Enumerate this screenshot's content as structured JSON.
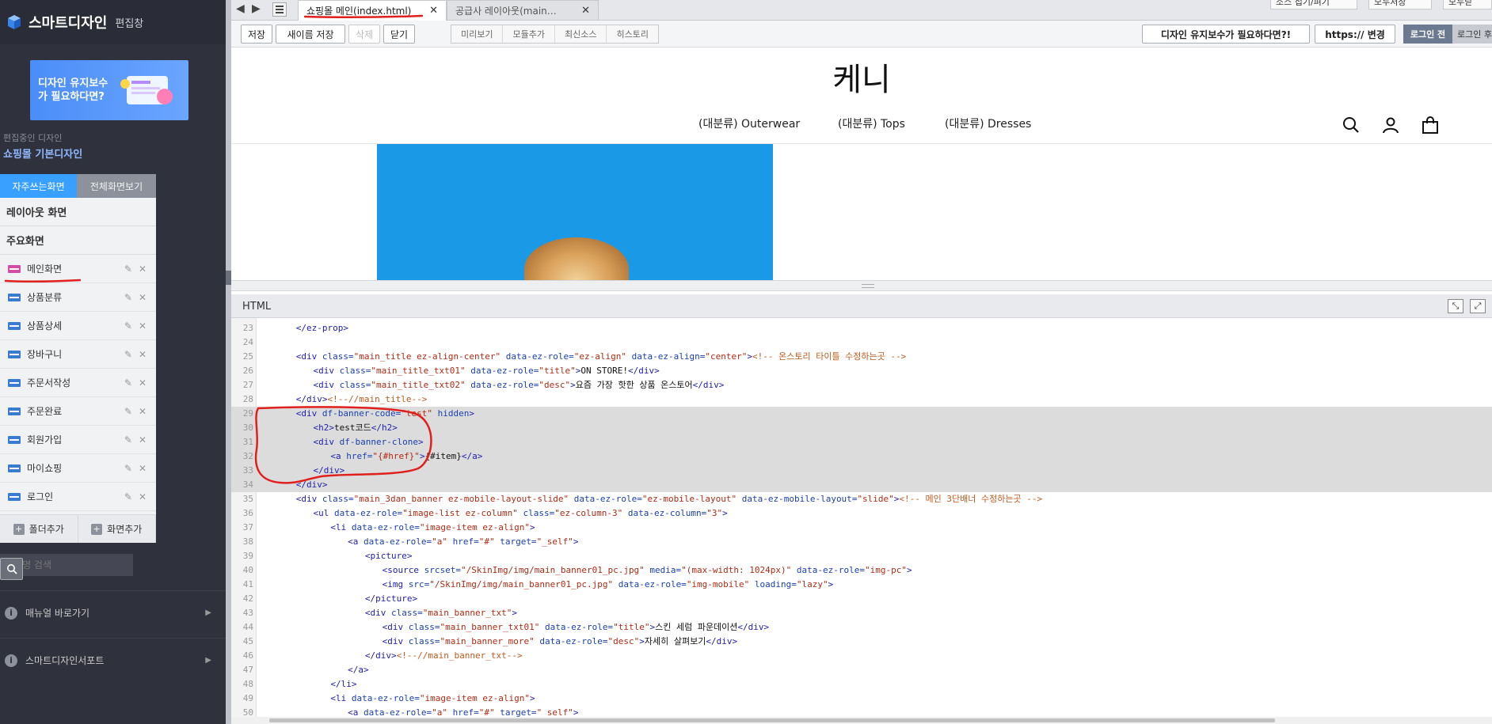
{
  "sidebar": {
    "brand": "스마트디자인",
    "brand_sub": "편집창",
    "banner_text": "디자인 유지보수가 필요하다면?",
    "design_label": "편집중인 디자인",
    "design_name": "쇼핑몰 기본디자인",
    "tabs": [
      "자주쓰는화면",
      "전체화면보기"
    ],
    "sections": [
      "레이아웃 화면",
      "주요화면"
    ],
    "items": [
      {
        "label": "메인화면"
      },
      {
        "label": "상품분류"
      },
      {
        "label": "상품상세"
      },
      {
        "label": "장바구니"
      },
      {
        "label": "주문서작성"
      },
      {
        "label": "주문완료"
      },
      {
        "label": "회원가입"
      },
      {
        "label": "마이쇼핑"
      },
      {
        "label": "로그인"
      }
    ],
    "add_folder": "폴더추가",
    "add_screen": "화면추가",
    "search_placeholder": "화면명 검색",
    "links": [
      "매뉴얼 바로가기",
      "스마트디자인서포트"
    ]
  },
  "tabbar": {
    "active_tab": "쇼핑몰 메인(index.html)",
    "inactive_tab": "공급사 레이아웃(main…",
    "right_buttons": [
      "소스 접기/펴기",
      "모두저장",
      "모두닫"
    ]
  },
  "toolbar": {
    "save": "저장",
    "save_as": "새이름 저장",
    "delete": "삭제",
    "close": "닫기",
    "segments": [
      "미리보기",
      "모듈추가",
      "최신소스",
      "히스토리"
    ],
    "maintenance": "디자인 유지보수가 필요하다면?!",
    "https": "https:// 변경",
    "login_before": "로그인 전",
    "login_after": "로그인 후"
  },
  "preview": {
    "shop_name": "케니",
    "nav": [
      "(대분류) Outerwear",
      "(대분류) Tops",
      "(대분류) Dresses"
    ]
  },
  "code_panel": {
    "title": "HTML"
  },
  "code_lines": [
    {
      "n": "23",
      "indent": 2,
      "hl": false,
      "parts": [
        [
          "t-tag",
          "</ez-prop>"
        ]
      ]
    },
    {
      "n": "24",
      "indent": 0,
      "hl": false,
      "parts": []
    },
    {
      "n": "25",
      "indent": 2,
      "hl": false,
      "parts": [
        [
          "t-tag",
          "<div "
        ],
        [
          "t-attr",
          "class="
        ],
        [
          "t-str",
          "\"main_title ez-align-center\""
        ],
        [
          "t-attr",
          " data-ez-role="
        ],
        [
          "t-str",
          "\"ez-align\""
        ],
        [
          "t-attr",
          " data-ez-align="
        ],
        [
          "t-str",
          "\"center\""
        ],
        [
          "t-tag",
          ">"
        ],
        [
          "t-com",
          "<!-- 온스토리 타이틀 수정하는곳 -->"
        ]
      ]
    },
    {
      "n": "26",
      "indent": 4,
      "hl": false,
      "parts": [
        [
          "t-tag",
          "<div "
        ],
        [
          "t-attr",
          "class="
        ],
        [
          "t-str",
          "\"main_title_txt01\""
        ],
        [
          "t-attr",
          " data-ez-role="
        ],
        [
          "t-str",
          "\"title\""
        ],
        [
          "t-tag",
          ">"
        ],
        [
          "t-txt",
          "ON STORE!"
        ],
        [
          "t-tag",
          "</div>"
        ]
      ]
    },
    {
      "n": "27",
      "indent": 4,
      "hl": false,
      "parts": [
        [
          "t-tag",
          "<div "
        ],
        [
          "t-attr",
          "class="
        ],
        [
          "t-str",
          "\"main_title_txt02\""
        ],
        [
          "t-attr",
          " data-ez-role="
        ],
        [
          "t-str",
          "\"desc\""
        ],
        [
          "t-tag",
          ">"
        ],
        [
          "t-txt",
          "요즘 가장 핫한 상품 온스토어"
        ],
        [
          "t-tag",
          "</div>"
        ]
      ]
    },
    {
      "n": "28",
      "indent": 2,
      "hl": false,
      "parts": [
        [
          "t-tag",
          "</div>"
        ],
        [
          "t-com",
          "<!--//main_title-->"
        ]
      ]
    },
    {
      "n": "29",
      "indent": 2,
      "hl": true,
      "parts": [
        [
          "t-tag",
          "<div "
        ],
        [
          "t-attr",
          "df-banner-code="
        ],
        [
          "t-str",
          "\"test\""
        ],
        [
          "t-attr",
          " hidden"
        ],
        [
          "t-tag",
          ">"
        ]
      ]
    },
    {
      "n": "30",
      "indent": 4,
      "hl": true,
      "parts": [
        [
          "t-tag",
          "<h2>"
        ],
        [
          "t-txt",
          "test코드"
        ],
        [
          "t-tag",
          "</h2>"
        ]
      ]
    },
    {
      "n": "31",
      "indent": 4,
      "hl": true,
      "parts": [
        [
          "t-tag",
          "<div "
        ],
        [
          "t-attr",
          "df-banner-clone"
        ],
        [
          "t-tag",
          ">"
        ]
      ]
    },
    {
      "n": "32",
      "indent": 6,
      "hl": true,
      "parts": [
        [
          "t-tag",
          "<a "
        ],
        [
          "t-attr",
          "href="
        ],
        [
          "t-str",
          "\"{#href}\""
        ],
        [
          "t-tag",
          ">"
        ],
        [
          "t-txt",
          "{#item}"
        ],
        [
          "t-tag",
          "</a>"
        ]
      ]
    },
    {
      "n": "33",
      "indent": 4,
      "hl": true,
      "parts": [
        [
          "t-tag",
          "</div>"
        ]
      ]
    },
    {
      "n": "34",
      "indent": 2,
      "hl": true,
      "parts": [
        [
          "t-tag",
          "</div>"
        ]
      ]
    },
    {
      "n": "35",
      "indent": 2,
      "hl": false,
      "parts": [
        [
          "t-tag",
          "<div "
        ],
        [
          "t-attr",
          "class="
        ],
        [
          "t-str",
          "\"main_3dan_banner ez-mobile-layout-slide\""
        ],
        [
          "t-attr",
          " data-ez-role="
        ],
        [
          "t-str",
          "\"ez-mobile-layout\""
        ],
        [
          "t-attr",
          " data-ez-mobile-layout="
        ],
        [
          "t-str",
          "\"slide\""
        ],
        [
          "t-tag",
          ">"
        ],
        [
          "t-com",
          "<!-- 메인 3단배너 수정하는곳 -->"
        ]
      ]
    },
    {
      "n": "36",
      "indent": 4,
      "hl": false,
      "parts": [
        [
          "t-tag",
          "<ul "
        ],
        [
          "t-attr",
          "data-ez-role="
        ],
        [
          "t-str",
          "\"image-list ez-column\""
        ],
        [
          "t-attr",
          " class="
        ],
        [
          "t-str",
          "\"ez-column-3\""
        ],
        [
          "t-attr",
          " data-ez-column="
        ],
        [
          "t-str",
          "\"3\""
        ],
        [
          "t-tag",
          ">"
        ]
      ]
    },
    {
      "n": "37",
      "indent": 6,
      "hl": false,
      "parts": [
        [
          "t-tag",
          "<li "
        ],
        [
          "t-attr",
          "data-ez-role="
        ],
        [
          "t-str",
          "\"image-item ez-align\""
        ],
        [
          "t-tag",
          ">"
        ]
      ]
    },
    {
      "n": "38",
      "indent": 8,
      "hl": false,
      "parts": [
        [
          "t-tag",
          "<a "
        ],
        [
          "t-attr",
          "data-ez-role="
        ],
        [
          "t-str",
          "\"a\""
        ],
        [
          "t-attr",
          " href="
        ],
        [
          "t-str",
          "\"#\""
        ],
        [
          "t-attr",
          " target="
        ],
        [
          "t-str",
          "\"_self\""
        ],
        [
          "t-tag",
          ">"
        ]
      ]
    },
    {
      "n": "39",
      "indent": 10,
      "hl": false,
      "parts": [
        [
          "t-tag",
          "<picture>"
        ]
      ]
    },
    {
      "n": "40",
      "indent": 12,
      "hl": false,
      "parts": [
        [
          "t-tag",
          "<source "
        ],
        [
          "t-attr",
          "srcset="
        ],
        [
          "t-str",
          "\"/SkinImg/img/main_banner01_pc.jpg\""
        ],
        [
          "t-attr",
          " media="
        ],
        [
          "t-str",
          "\"(max-width: 1024px)\""
        ],
        [
          "t-attr",
          " data-ez-role="
        ],
        [
          "t-str",
          "\"img-pc\""
        ],
        [
          "t-tag",
          ">"
        ]
      ]
    },
    {
      "n": "41",
      "indent": 12,
      "hl": false,
      "parts": [
        [
          "t-tag",
          "<img "
        ],
        [
          "t-attr",
          "src="
        ],
        [
          "t-str",
          "\"/SkinImg/img/main_banner01_pc.jpg\""
        ],
        [
          "t-attr",
          " data-ez-role="
        ],
        [
          "t-str",
          "\"img-mobile\""
        ],
        [
          "t-attr",
          " loading="
        ],
        [
          "t-str",
          "\"lazy\""
        ],
        [
          "t-tag",
          ">"
        ]
      ]
    },
    {
      "n": "42",
      "indent": 10,
      "hl": false,
      "parts": [
        [
          "t-tag",
          "</picture>"
        ]
      ]
    },
    {
      "n": "43",
      "indent": 10,
      "hl": false,
      "parts": [
        [
          "t-tag",
          "<div "
        ],
        [
          "t-attr",
          "class="
        ],
        [
          "t-str",
          "\"main_banner_txt\""
        ],
        [
          "t-tag",
          ">"
        ]
      ]
    },
    {
      "n": "44",
      "indent": 12,
      "hl": false,
      "parts": [
        [
          "t-tag",
          "<div "
        ],
        [
          "t-attr",
          "class="
        ],
        [
          "t-str",
          "\"main_banner_txt01\""
        ],
        [
          "t-attr",
          " data-ez-role="
        ],
        [
          "t-str",
          "\"title\""
        ],
        [
          "t-tag",
          ">"
        ],
        [
          "t-txt",
          "스킨 세럼 파운데이션"
        ],
        [
          "t-tag",
          "</div>"
        ]
      ]
    },
    {
      "n": "45",
      "indent": 12,
      "hl": false,
      "parts": [
        [
          "t-tag",
          "<div "
        ],
        [
          "t-attr",
          "class="
        ],
        [
          "t-str",
          "\"main_banner_more\""
        ],
        [
          "t-attr",
          " data-ez-role="
        ],
        [
          "t-str",
          "\"desc\""
        ],
        [
          "t-tag",
          ">"
        ],
        [
          "t-txt",
          "자세히 살펴보기"
        ],
        [
          "t-tag",
          "</div>"
        ]
      ]
    },
    {
      "n": "46",
      "indent": 10,
      "hl": false,
      "parts": [
        [
          "t-tag",
          "</div>"
        ],
        [
          "t-com",
          "<!--//main_banner_txt-->"
        ]
      ]
    },
    {
      "n": "47",
      "indent": 8,
      "hl": false,
      "parts": [
        [
          "t-tag",
          "</a>"
        ]
      ]
    },
    {
      "n": "48",
      "indent": 6,
      "hl": false,
      "parts": [
        [
          "t-tag",
          "</li>"
        ]
      ]
    },
    {
      "n": "49",
      "indent": 6,
      "hl": false,
      "parts": [
        [
          "t-tag",
          "<li "
        ],
        [
          "t-attr",
          "data-ez-role="
        ],
        [
          "t-str",
          "\"image-item ez-align\""
        ],
        [
          "t-tag",
          ">"
        ]
      ]
    },
    {
      "n": "50",
      "indent": 8,
      "hl": false,
      "parts": [
        [
          "t-tag",
          "<a "
        ],
        [
          "t-attr",
          "data-ez-role="
        ],
        [
          "t-str",
          "\"a\""
        ],
        [
          "t-attr",
          " href="
        ],
        [
          "t-str",
          "\"#\""
        ],
        [
          "t-attr",
          " target="
        ],
        [
          "t-str",
          "\"_self\""
        ],
        [
          "t-tag",
          ">"
        ]
      ]
    }
  ],
  "colors": {
    "sidebar_bg": "#2f323d",
    "tab_active": "#3aa0ff",
    "hero_blue": "#1a9ae6",
    "annotation_red": "#e0201c",
    "code_highlight": "#dcdcdc"
  }
}
